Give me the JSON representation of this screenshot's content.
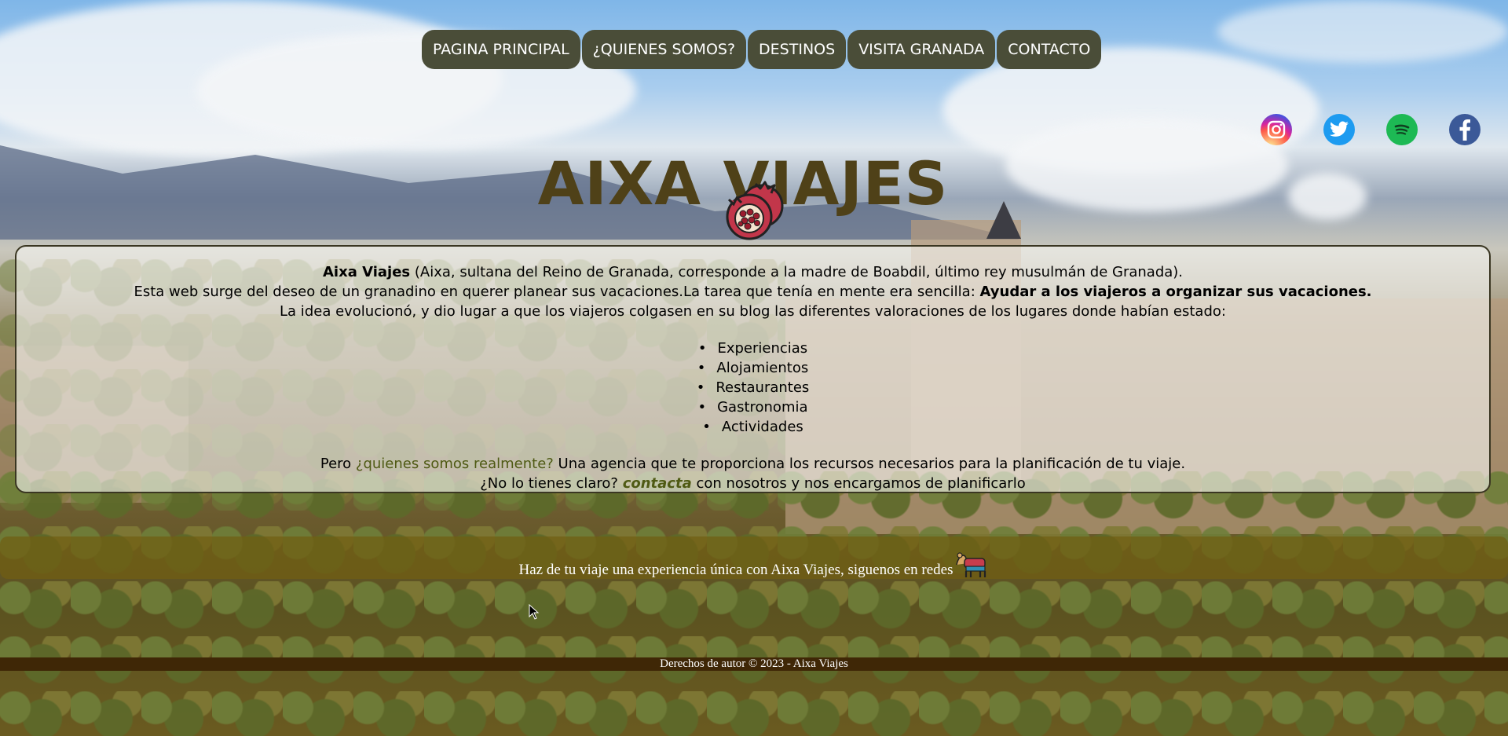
{
  "nav": {
    "items": [
      {
        "label": "PAGINA PRINCIPAL"
      },
      {
        "label": "¿QUIENES SOMOS?"
      },
      {
        "label": "DESTINOS"
      },
      {
        "label": "VISITA GRANADA"
      },
      {
        "label": "CONTACTO"
      }
    ]
  },
  "header": {
    "title": "AIXA VIAJES"
  },
  "social": {
    "icons": [
      "instagram-icon",
      "twitter-icon",
      "spotify-icon",
      "facebook-icon"
    ]
  },
  "intro": {
    "line1_bold": "Aixa Viajes",
    "line1_rest": " (Aixa, sultana del Reino de Granada, corresponde a la madre de Boabdil, último rey musulmán de Granada).",
    "line2_start": "Esta web surge del deseo de un granadino en querer planear sus vacaciones.La tarea que tenía en mente era sencilla: ",
    "line2_bold": "Ayudar a los viajeros a organizar sus vacaciones.",
    "line3": "La idea evolucionó, y dio lugar a que los viajeros colgasen en su blog las diferentes valoraciones de los lugares donde habían estado:",
    "list": [
      "Experiencias",
      "Alojamientos",
      "Restaurantes",
      "Gastronomia",
      "Actividades"
    ],
    "line4_start": "Pero ",
    "line4_link": "¿quienes somos realmente?",
    "line4_rest": " Una agencia que te proporciona los recursos necesarios para la planificación de tu viaje.",
    "line5_start": "¿No lo tienes claro? ",
    "line5_link": "contacta",
    "line5_rest": " con nosotros y nos encargamos de planificarlo"
  },
  "band": {
    "text": "Haz de tu viaje una experiencia única con Aixa Viajes, siguenos en redes"
  },
  "footer": {
    "text": "Derechos de autor © 2023 - Aixa Viajes"
  },
  "colors": {
    "nav_bg": "#4a4d38",
    "title": "#4f4118",
    "link": "#4f5a14",
    "band": "#705e12",
    "footer": "#3f2706"
  }
}
